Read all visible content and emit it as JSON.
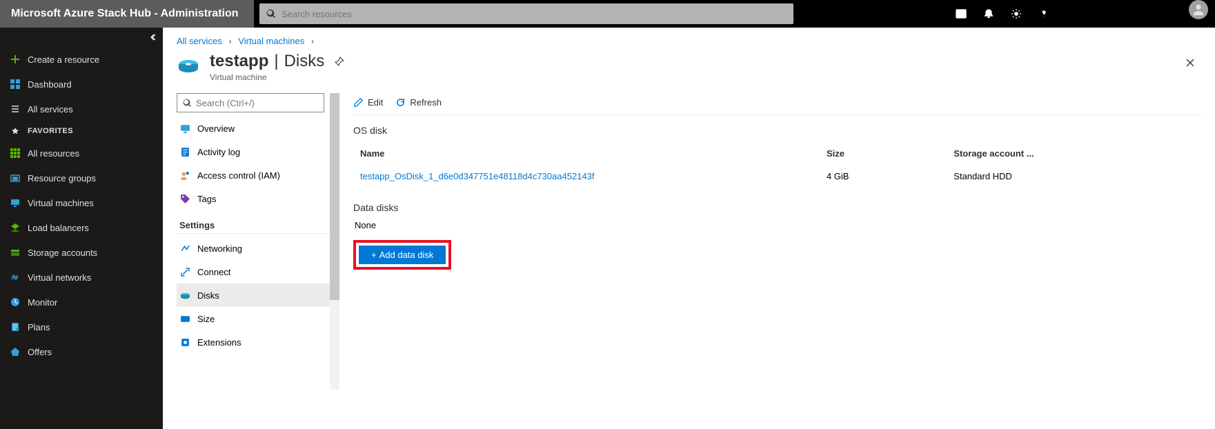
{
  "topbar": {
    "title": "Microsoft Azure Stack Hub - Administration",
    "search_placeholder": "Search resources"
  },
  "sidebar": {
    "create": "Create a resource",
    "dashboard": "Dashboard",
    "all_services": "All services",
    "favorites_label": "FAVORITES",
    "items": [
      "All resources",
      "Resource groups",
      "Virtual machines",
      "Load balancers",
      "Storage accounts",
      "Virtual networks",
      "Monitor",
      "Plans",
      "Offers"
    ]
  },
  "breadcrumb": {
    "all_services": "All services",
    "vms": "Virtual machines"
  },
  "page": {
    "name": "testapp",
    "section": "Disks",
    "subtitle": "Virtual machine"
  },
  "menu": {
    "search_placeholder": "Search (Ctrl+/)",
    "overview": "Overview",
    "activity": "Activity log",
    "access": "Access control (IAM)",
    "tags": "Tags",
    "settings_label": "Settings",
    "networking": "Networking",
    "connect": "Connect",
    "disks": "Disks",
    "size": "Size",
    "extensions": "Extensions"
  },
  "toolbar": {
    "edit": "Edit",
    "refresh": "Refresh"
  },
  "os_disk": {
    "title": "OS disk",
    "col_name": "Name",
    "col_size": "Size",
    "col_storage": "Storage account ...",
    "row": {
      "name": "testapp_OsDisk_1_d6e0d347751e48118d4c730aa452143f",
      "size": "4 GiB",
      "storage": "Standard HDD"
    }
  },
  "data_disks": {
    "title": "Data disks",
    "none": "None",
    "add_label": "Add data disk"
  }
}
